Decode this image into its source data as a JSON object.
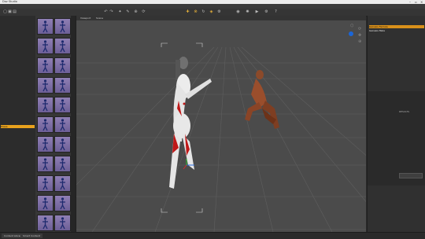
{
  "window": {
    "title": "Daz Studio"
  },
  "viewport": {
    "tabs": [
      "Viewport",
      "Scene"
    ]
  },
  "left_panel": {
    "selected_tree_item": "Poses",
    "thumb_caption_hint": ""
  },
  "right_panel": {
    "scene_items": [
      "Genesis Female",
      "Genesis Male"
    ],
    "side_label": "RESULTS"
  },
  "status": {
    "tabs": [
      "Content Library",
      "Smart Content"
    ]
  },
  "colors": {
    "accent": "#e8a21d",
    "viewport_bg": "#4b4b4b",
    "thumb_bg": "#8f7fb4"
  }
}
